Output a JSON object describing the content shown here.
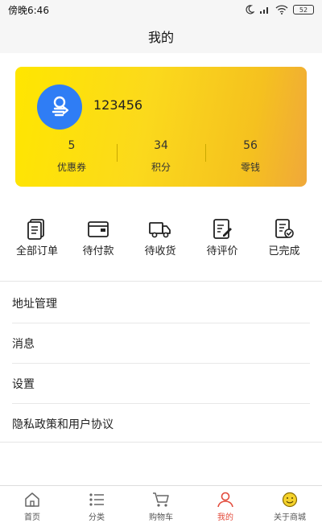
{
  "status_bar": {
    "time": "傍晚6:46",
    "battery": "52"
  },
  "header": {
    "title": "我的"
  },
  "profile": {
    "username": "123456",
    "stats": [
      {
        "value": "5",
        "label": "优惠券"
      },
      {
        "value": "34",
        "label": "积分"
      },
      {
        "value": "56",
        "label": "零钱"
      }
    ]
  },
  "orders": [
    {
      "label": "全部订单",
      "icon": "all-orders-icon"
    },
    {
      "label": "待付款",
      "icon": "wallet-icon"
    },
    {
      "label": "待收货",
      "icon": "truck-icon"
    },
    {
      "label": "待评价",
      "icon": "edit-note-icon"
    },
    {
      "label": "已完成",
      "icon": "completed-check-icon"
    }
  ],
  "menu": [
    {
      "label": "地址管理"
    },
    {
      "label": "消息"
    },
    {
      "label": "设置"
    },
    {
      "label": "隐私政策和用户协议"
    }
  ],
  "tabs": [
    {
      "label": "首页",
      "icon": "home-icon"
    },
    {
      "label": "分类",
      "icon": "category-icon"
    },
    {
      "label": "购物车",
      "icon": "cart-icon"
    },
    {
      "label": "我的",
      "icon": "user-icon",
      "active": true
    },
    {
      "label": "关于商城",
      "icon": "smile-icon"
    }
  ],
  "colors": {
    "accent": "#e24a3b",
    "card_start": "#ffe600",
    "card_end": "#f0a83a",
    "avatar_bg": "#2f7df5"
  }
}
